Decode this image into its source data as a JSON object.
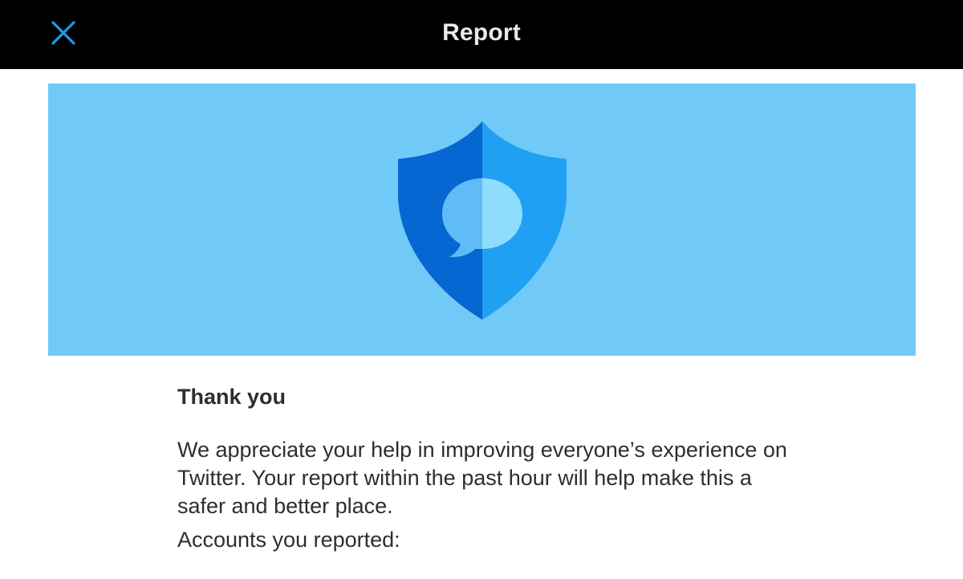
{
  "header": {
    "title": "Report",
    "close_icon": "close-icon",
    "accent_color": "#1d9bf0",
    "background_color": "#000000"
  },
  "banner": {
    "background_color": "#71c9f8",
    "illustration": "shield-chat-icon"
  },
  "content": {
    "heading": "Thank you",
    "body": "We appreciate your help in improving everyone’s experience on Twitter. Your report within the past hour will help make this a safer and better place.",
    "accounts_label": "Accounts you reported:"
  }
}
